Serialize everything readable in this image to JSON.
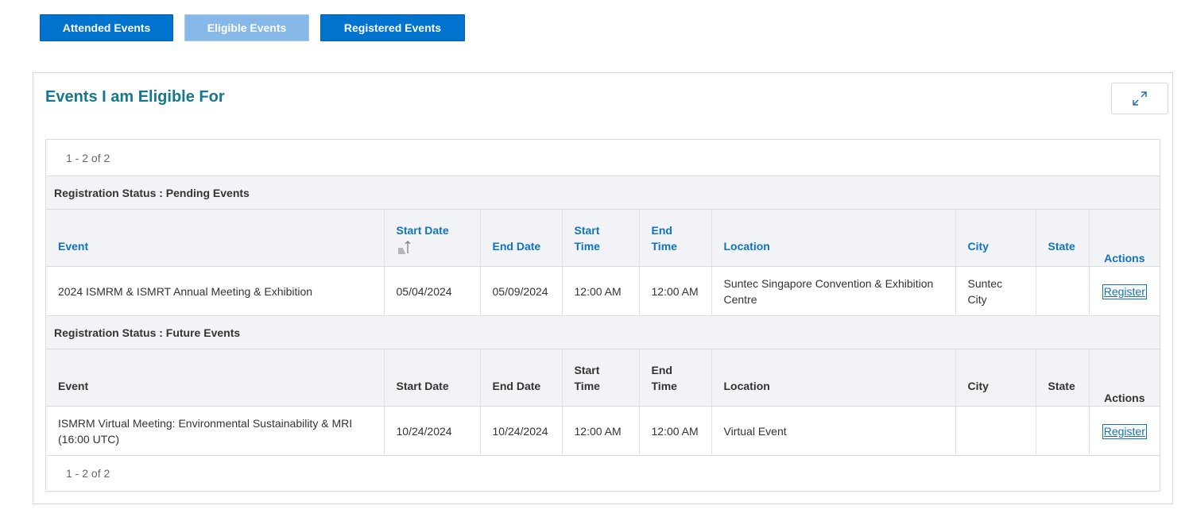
{
  "tabs": {
    "attended": "Attended Events",
    "eligible": "Eligible Events",
    "registered": "Registered Events"
  },
  "panel": {
    "title": "Events I am Eligible For",
    "expand_icon": "expand-arrows-icon"
  },
  "pager": {
    "top": "1 - 2 of 2",
    "bottom": "1 - 2 of 2"
  },
  "columns": {
    "event": "Event",
    "start_date": "Start Date",
    "end_date": "End Date",
    "start_time_1": "Start",
    "start_time_2": "Time",
    "end_time_1": "End",
    "end_time_2": "Time",
    "location": "Location",
    "city": "City",
    "state": "State",
    "actions": "Actions"
  },
  "groups": [
    {
      "label": "Registration Status : Pending Events",
      "rows": [
        {
          "event": "2024 ISMRM & ISMRT Annual Meeting & Exhibition",
          "start_date": "05/04/2024",
          "end_date": "05/09/2024",
          "start_time": "12:00 AM",
          "end_time": "12:00 AM",
          "location": "Suntec Singapore Convention & Exhibition Centre",
          "city": "Suntec City",
          "state": "",
          "action": "Register"
        }
      ]
    },
    {
      "label": "Registration Status : Future Events",
      "rows": [
        {
          "event": "ISMRM Virtual Meeting: Environmental Sustainability & MRI (16:00 UTC)",
          "start_date": "10/24/2024",
          "end_date": "10/24/2024",
          "start_time": "12:00 AM",
          "end_time": "12:00 AM",
          "location": "Virtual Event",
          "city": "",
          "state": "",
          "action": "Register"
        }
      ]
    }
  ],
  "colors": {
    "button_primary": "#0073cf",
    "button_disabled": "#86b9e7",
    "title": "#15788f",
    "link": "#0f72c2",
    "header_bg": "#f2f3f6"
  }
}
